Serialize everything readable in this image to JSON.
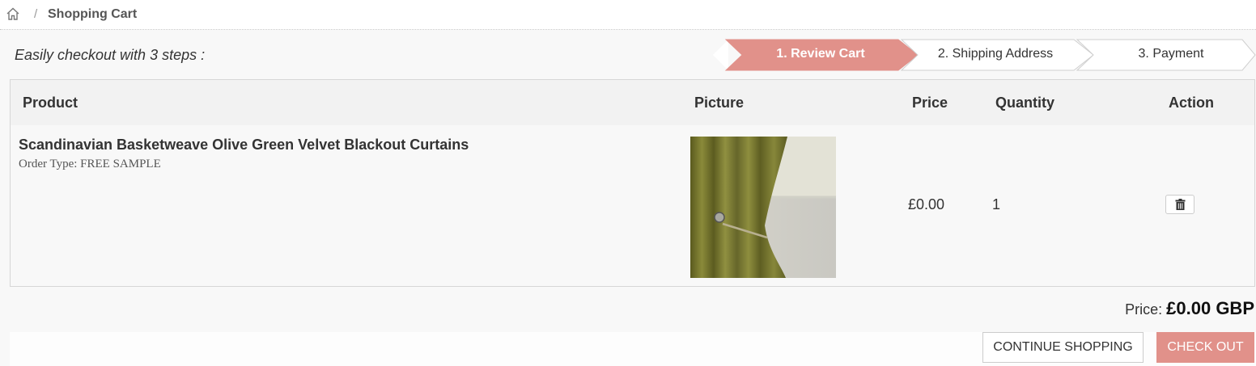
{
  "breadcrumb": {
    "home_icon": "home-icon",
    "separator": "/",
    "current": "Shopping Cart"
  },
  "steps": {
    "intro": "Easily checkout with 3 steps :",
    "items": [
      {
        "label": "1. Review Cart",
        "active": true
      },
      {
        "label": "2. Shipping Address",
        "active": false
      },
      {
        "label": "3. Payment",
        "active": false
      }
    ],
    "active_color": "#e1918a"
  },
  "table": {
    "headers": {
      "product": "Product",
      "picture": "Picture",
      "price": "Price",
      "quantity": "Quantity",
      "action": "Action"
    },
    "rows": [
      {
        "product_name": "Scandinavian Basketweave Olive Green Velvet Blackout Curtains",
        "order_type": "Order Type: FREE SAMPLE",
        "picture": "olive-green-curtain-photo",
        "price": "£0.00",
        "quantity": "1",
        "action_icon": "trash-icon"
      }
    ]
  },
  "summary": {
    "label": "Price:",
    "value": "£0.00 GBP"
  },
  "buttons": {
    "continue": "CONTINUE SHOPPING",
    "checkout": "CHECK OUT"
  }
}
